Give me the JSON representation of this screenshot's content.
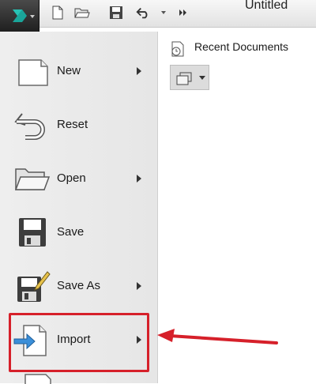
{
  "window": {
    "title": "Untitled"
  },
  "toolbar": {
    "app_button_icon": "3ds-max-logo-icon",
    "quick_access": [
      {
        "name": "new-file-icon"
      },
      {
        "name": "open-folder-icon"
      },
      {
        "name": "save-icon"
      },
      {
        "name": "undo-icon"
      },
      {
        "name": "dropdown-icon"
      },
      {
        "name": "overflow-icon"
      }
    ]
  },
  "menu": {
    "items": [
      {
        "label": "New",
        "icon": "new-document-icon",
        "submenu": true
      },
      {
        "label": "Reset",
        "icon": "reset-icon",
        "submenu": false
      },
      {
        "label": "Open",
        "icon": "open-folder-icon",
        "submenu": true
      },
      {
        "label": "Save",
        "icon": "save-disk-icon",
        "submenu": false
      },
      {
        "label": "Save As",
        "icon": "save-as-icon",
        "submenu": true
      },
      {
        "label": "Import",
        "icon": "import-icon",
        "submenu": true
      }
    ]
  },
  "recent": {
    "label": "Recent Documents",
    "icon": "recent-documents-icon",
    "view_button_icon": "view-options-icon"
  },
  "colors": {
    "highlight": "#d6202a",
    "app_button": "#2b2b2b",
    "logo_teal": "#1aa59a"
  }
}
